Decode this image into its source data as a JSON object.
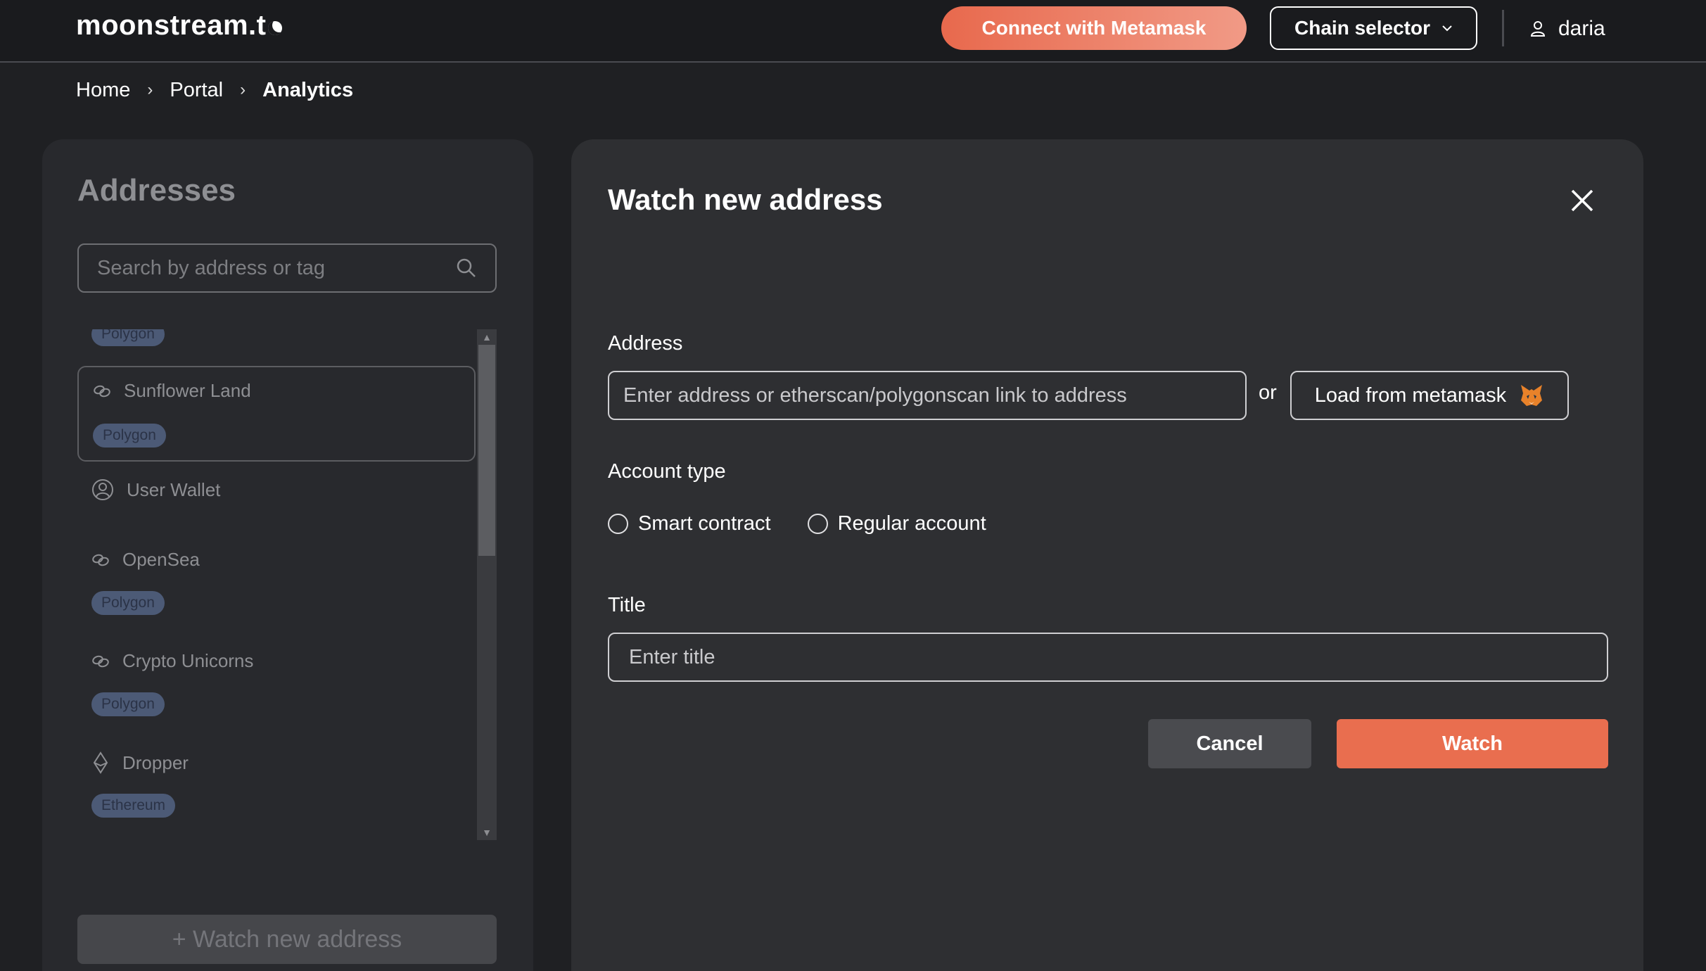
{
  "nav": {
    "logo_text": "moonstream.t",
    "connect_label": "Connect with Metamask",
    "chain_selector_label": "Chain selector",
    "username": "daria"
  },
  "breadcrumb": {
    "home": "Home",
    "portal": "Portal",
    "current": "Analytics",
    "separator": "›"
  },
  "sidebar": {
    "title": "Addresses",
    "search_placeholder": "Search by address or tag",
    "items": [
      {
        "label": "",
        "tag": "Polygon",
        "icon": "link-icon"
      },
      {
        "label": "Sunflower Land",
        "tag": "Polygon",
        "icon": "link-icon",
        "selected": true
      },
      {
        "label": "User Wallet",
        "tag": "",
        "icon": "user-circle-icon"
      },
      {
        "label": "OpenSea",
        "tag": "Polygon",
        "icon": "link-icon"
      },
      {
        "label": "Crypto Unicorns",
        "tag": "Polygon",
        "icon": "link-icon"
      },
      {
        "label": "Dropper",
        "tag": "Ethereum",
        "icon": "ethereum-icon"
      }
    ],
    "watch_new_label": "+ Watch new address"
  },
  "modal": {
    "title": "Watch new address",
    "address_label": "Address",
    "address_placeholder": "Enter address or etherscan/polygonscan link to address",
    "or_text": "or",
    "load_metamask_label": "Load from metamask",
    "account_type_label": "Account type",
    "account_types": [
      "Smart contract",
      "Regular account"
    ],
    "title_label": "Title",
    "title_placeholder": "Enter title",
    "cancel_label": "Cancel",
    "watch_label": "Watch"
  },
  "colors": {
    "accent": "#e96e4f",
    "background": "#1f2023",
    "panel": "#28292d",
    "modal": "#2e2f32",
    "tag_bg": "#4c5a76"
  }
}
